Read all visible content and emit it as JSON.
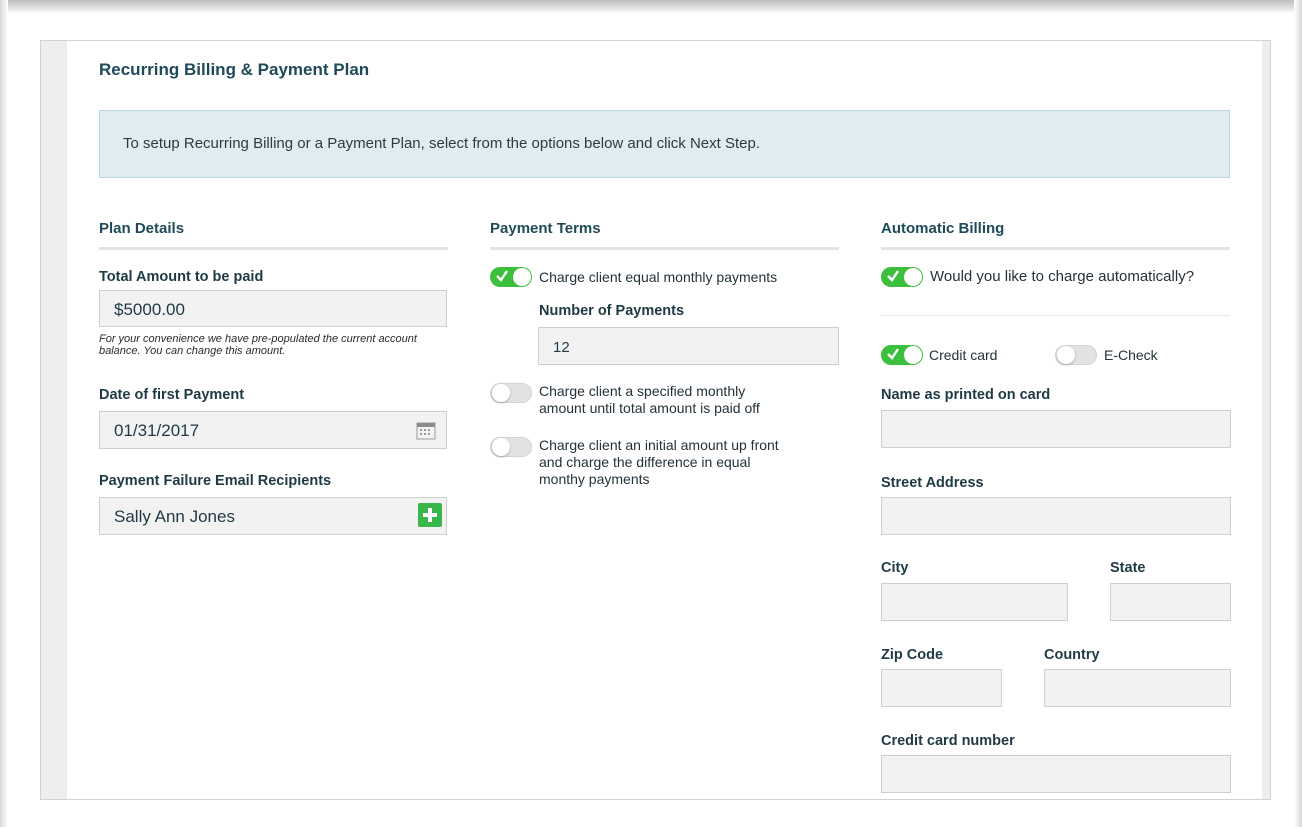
{
  "page_title": "Recurring Billing & Payment Plan",
  "info_text": "To setup Recurring Billing or a Payment Plan, select from the options below and click Next Step.",
  "plan_details": {
    "heading": "Plan Details",
    "total_label": "Total Amount to be paid",
    "total_value": "$5000.00",
    "total_note": "For your convenience we have pre-populated the current account balance. You can change this amount.",
    "date_label": "Date of first Payment",
    "date_value": "01/31/2017",
    "recipients_label": "Payment Failure Email Recipients",
    "recipients_value": "Sally Ann Jones"
  },
  "payment_terms": {
    "heading": "Payment Terms",
    "option1": {
      "label": "Charge client equal monthly payments",
      "on": true
    },
    "num_payments_label": "Number of Payments",
    "num_payments_value": "12",
    "option2": {
      "label_line1": "Charge client a specified monthly",
      "label_line2": "amount until total amount is paid off",
      "on": false
    },
    "option3": {
      "label_line1": "Charge client an initial amount up front",
      "label_line2": "and charge the difference in equal",
      "label_line3": "monthy payments",
      "on": false
    }
  },
  "automatic_billing": {
    "heading": "Automatic Billing",
    "auto_charge_label": "Would you like to charge automatically?",
    "auto_charge_on": true,
    "credit_card_label": "Credit card",
    "credit_card_on": true,
    "echeck_label": "E-Check",
    "echeck_on": false,
    "name_label": "Name as printed on card",
    "street_label": "Street Address",
    "city_label": "City",
    "state_label": "State",
    "zip_label": "Zip Code",
    "country_label": "Country",
    "cc_number_label": "Credit card number"
  },
  "colors": {
    "heading": "#1e4a5a",
    "toggle_on": "#3cbf3c",
    "info_bg": "#dfedf1",
    "add_button": "#39b54a"
  }
}
